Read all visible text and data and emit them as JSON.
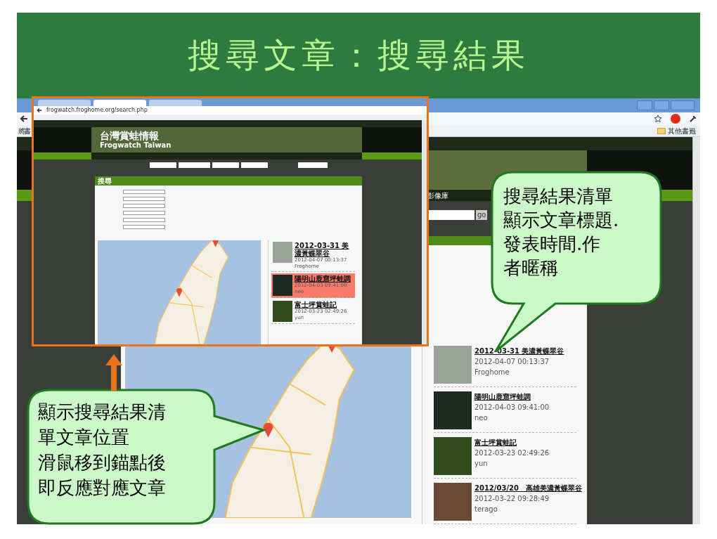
{
  "slide": {
    "title": "搜尋文章：搜尋結果"
  },
  "browser": {
    "bookmarks_left": "將書",
    "bookmarks_folder": "其他書籤",
    "nav_item": "影像庫",
    "search_button": "go",
    "results": [
      {
        "title": "2012-03-31 美濃黃蝶翠谷",
        "date": "2012-04-07 00:13:37",
        "author": "Froghome"
      },
      {
        "title": "陽明山鹿窟坪蛙調",
        "date": "2012-04-03 09:41:00",
        "author": "neo"
      },
      {
        "title": "富士坪賞蛙記",
        "date": "2012-03-23 02:49:26",
        "author": "yun"
      },
      {
        "title": "2012/03/20　高雄美濃黃蝶翠谷",
        "date": "2012-03-22 09:28:49",
        "author": "terago"
      }
    ]
  },
  "inset_browser": {
    "tabs": [
      {
        "selected": false
      },
      {
        "selected": true
      },
      {
        "selected": false
      }
    ],
    "address": "frogwatch.froghome.org/search.php",
    "site_title": "台灣賞蛙情報",
    "site_subtitle": "Frogwatch Taiwan",
    "panel_title": "搜尋",
    "results": [
      {
        "title": "2012-03-31 美濃黃蝶翠谷",
        "date": "2012-04-07 00:13:37",
        "author": "Froghome",
        "selected": false
      },
      {
        "title": "陽明山鹿窟坪蛙調",
        "date": "2012-04-03 09:41:00",
        "author": "neo",
        "selected": true
      },
      {
        "title": "富士坪賞蛙記",
        "date": "2012-03-23 02:49:26",
        "author": "yun",
        "selected": false
      }
    ]
  },
  "callouts": [
    {
      "lines": [
        "搜尋結果清單",
        "顯示文章標題.",
        "發表時間.作",
        "者暱稱"
      ]
    },
    {
      "lines": [
        "顯示搜尋結果清",
        "單文章位置",
        "滑鼠移到錨點後",
        "即反應對應文章"
      ]
    }
  ]
}
